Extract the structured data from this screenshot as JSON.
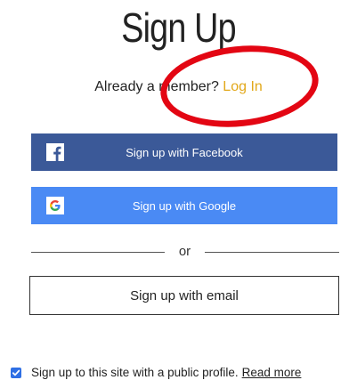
{
  "header": {
    "title": "Sign Up",
    "member_prompt": "Already a member?",
    "login_link": "Log In"
  },
  "social": {
    "facebook_label": "Sign up with Facebook",
    "google_label": "Sign up with Google",
    "facebook_color": "#3b5998",
    "google_color": "#4a8af4"
  },
  "divider": {
    "text": "or"
  },
  "email": {
    "label": "Sign up with email"
  },
  "profile": {
    "checked": true,
    "text": "Sign up to this site with a public profile.",
    "read_more": "Read more"
  },
  "colors": {
    "link": "#e2a81a",
    "annotation": "#e30613",
    "checkbox": "#2f6fe4"
  },
  "icons": {
    "facebook": "facebook-icon",
    "google": "google-icon",
    "checkmark": "check-icon"
  }
}
